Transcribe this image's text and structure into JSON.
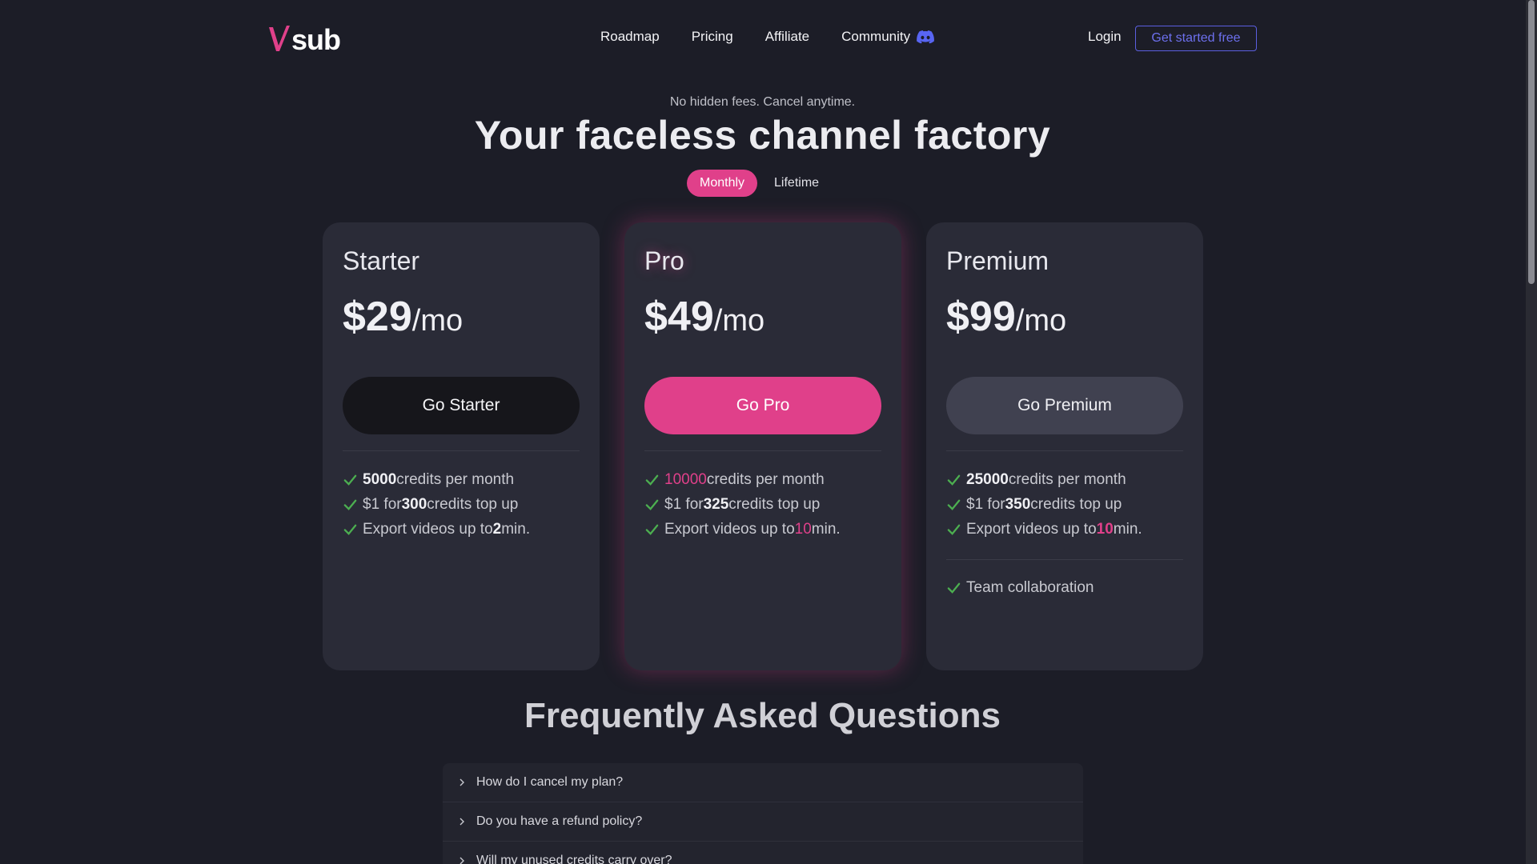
{
  "header": {
    "logo_text": "sub",
    "nav": {
      "roadmap": "Roadmap",
      "pricing": "Pricing",
      "affiliate": "Affiliate",
      "community": "Community"
    },
    "login": "Login",
    "cta": "Get started free"
  },
  "hero": {
    "tagline": "No hidden fees. Cancel anytime.",
    "headline": "Your faceless channel factory",
    "toggle": {
      "monthly": "Monthly",
      "lifetime": "Lifetime",
      "selected": "Monthly"
    }
  },
  "plans": [
    {
      "name": "Starter",
      "price": "$29",
      "per": "/mo",
      "button": "Go Starter",
      "f1_value": "5000",
      "f1_text": " credits per month",
      "f2_prefix": "$1 for ",
      "f2_value": "300",
      "f2_text": " credits top up",
      "f3_prefix": "Export videos up to ",
      "f3_value": "2",
      "f3_text": " min."
    },
    {
      "name": "Pro",
      "price": "$49",
      "per": "/mo",
      "button": "Go Pro",
      "f1_value": "10000",
      "f1_text": " credits per month",
      "f2_prefix": "$1 for ",
      "f2_value": "325",
      "f2_text": " credits top up",
      "f3_prefix": "Export videos up to ",
      "f3_value": "10",
      "f3_text": " min."
    },
    {
      "name": "Premium",
      "price": "$99",
      "per": "/mo",
      "button": "Go Premium",
      "f1_value": "25000",
      "f1_text": " credits per month",
      "f2_prefix": "$1 for ",
      "f2_value": "350",
      "f2_text": " credits top up",
      "f3_prefix": "Export videos up to ",
      "f3_value": "10",
      "f3_text": " min.",
      "extra": "Team collaboration"
    }
  ],
  "faq": {
    "title": "Frequently Asked Questions",
    "items": [
      "How do I cancel my plan?",
      "Do you have a refund policy?",
      "Will my unused credits carry over?"
    ]
  },
  "colors": {
    "background": "#1c1d27",
    "card": "#2a2b37",
    "accent": "#e0408a",
    "cta_border": "#5b5fe0",
    "check": "#4caf50"
  },
  "icons": [
    "discord-icon",
    "check-icon",
    "chevron-right-icon"
  ]
}
